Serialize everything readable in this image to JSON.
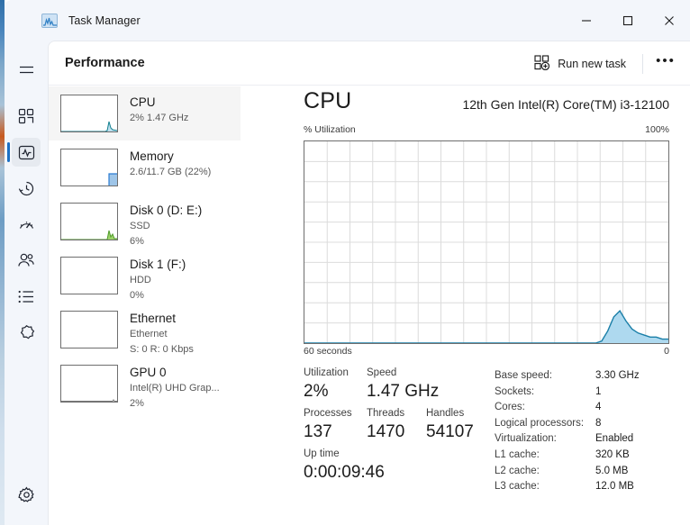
{
  "window": {
    "title": "Task Manager",
    "app_icon": "task-manager-icon",
    "minimize": "—",
    "maximize": "□",
    "close": "✕"
  },
  "rail": {
    "menu_icon": "hamburger-menu-icon",
    "items": [
      {
        "name": "processes",
        "icon": "grid-processes-icon",
        "selected": false
      },
      {
        "name": "performance",
        "icon": "pulse-performance-icon",
        "selected": true
      },
      {
        "name": "app-history",
        "icon": "clock-history-icon",
        "selected": false
      },
      {
        "name": "startup-apps",
        "icon": "gauge-startup-icon",
        "selected": false
      },
      {
        "name": "users",
        "icon": "people-users-icon",
        "selected": false
      },
      {
        "name": "details",
        "icon": "list-details-icon",
        "selected": false
      },
      {
        "name": "services",
        "icon": "cog-services-icon",
        "selected": false
      }
    ],
    "settings": {
      "name": "settings",
      "icon": "gear-settings-icon"
    }
  },
  "toolbar": {
    "page_title": "Performance",
    "run_new_task_label": "Run new task",
    "run_new_task_icon": "new-task-icon",
    "more_label": "•••"
  },
  "resources": [
    {
      "name": "CPU",
      "line2": "2%  1.47 GHz",
      "line3": "",
      "selected": true,
      "spark": "cpu"
    },
    {
      "name": "Memory",
      "line2": "2.6/11.7 GB (22%)",
      "line3": "",
      "selected": false,
      "spark": "memory"
    },
    {
      "name": "Disk 0 (D: E:)",
      "line2": "SSD",
      "line3": "6%",
      "selected": false,
      "spark": "disk0"
    },
    {
      "name": "Disk 1 (F:)",
      "line2": "HDD",
      "line3": "0%",
      "selected": false,
      "spark": "none"
    },
    {
      "name": "Ethernet",
      "line2": "Ethernet",
      "line3": "S: 0 R: 0 Kbps",
      "selected": false,
      "spark": "none"
    },
    {
      "name": "GPU 0",
      "line2": "Intel(R) UHD Grap...",
      "line3": "2%",
      "selected": false,
      "spark": "gpu"
    }
  ],
  "detail": {
    "title": "CPU",
    "subtitle": "12th Gen Intel(R) Core(TM) i3-12100",
    "axis_top_left": "% Utilization",
    "axis_top_right": "100%",
    "axis_bottom_left": "60 seconds",
    "axis_bottom_right": "0",
    "stats": {
      "utilization_label": "Utilization",
      "utilization_value": "2%",
      "speed_label": "Speed",
      "speed_value": "1.47 GHz",
      "processes_label": "Processes",
      "processes_value": "137",
      "threads_label": "Threads",
      "threads_value": "1470",
      "handles_label": "Handles",
      "handles_value": "54107",
      "uptime_label": "Up time",
      "uptime_value": "0:00:09:46"
    },
    "specs": [
      {
        "key": "Base speed:",
        "value": "3.30 GHz"
      },
      {
        "key": "Sockets:",
        "value": "1"
      },
      {
        "key": "Cores:",
        "value": "4"
      },
      {
        "key": "Logical processors:",
        "value": "8"
      },
      {
        "key": "Virtualization:",
        "value": "Enabled"
      },
      {
        "key": "L1 cache:",
        "value": "320 KB"
      },
      {
        "key": "L2 cache:",
        "value": "5.0 MB"
      },
      {
        "key": "L3 cache:",
        "value": "12.0 MB"
      }
    ]
  },
  "chart_data": {
    "type": "area",
    "title": "CPU % Utilization over 60 seconds",
    "xlabel": "60 seconds",
    "ylabel": "% Utilization",
    "ylim": [
      0,
      100
    ],
    "xlim": [
      60,
      0
    ],
    "grid": true,
    "grid_columns": 16,
    "grid_rows": 10,
    "stroke_color": "#1a7fa8",
    "fill_color": "#aed9ef",
    "x": [
      60,
      59,
      58,
      57,
      56,
      55,
      54,
      53,
      52,
      51,
      50,
      49,
      48,
      47,
      46,
      45,
      44,
      43,
      42,
      41,
      40,
      39,
      38,
      37,
      36,
      35,
      34,
      33,
      32,
      31,
      30,
      29,
      28,
      27,
      26,
      25,
      24,
      23,
      22,
      21,
      20,
      19,
      18,
      17,
      16,
      15,
      14,
      13,
      12,
      11,
      10,
      9,
      8,
      7,
      6,
      5,
      4,
      3,
      2,
      1,
      0
    ],
    "values": [
      0,
      0,
      0,
      0,
      0,
      0,
      0,
      0,
      0,
      0,
      0,
      0,
      0,
      0,
      0,
      0,
      0,
      0,
      0,
      0,
      0,
      0,
      0,
      0,
      0,
      0,
      0,
      0,
      0,
      0,
      0,
      0,
      0,
      0,
      0,
      0,
      0,
      0,
      0,
      0,
      0,
      0,
      0,
      0,
      0,
      0,
      0,
      0,
      0,
      1,
      6,
      13,
      16,
      11,
      7,
      5,
      4,
      3,
      3,
      2,
      2
    ]
  }
}
